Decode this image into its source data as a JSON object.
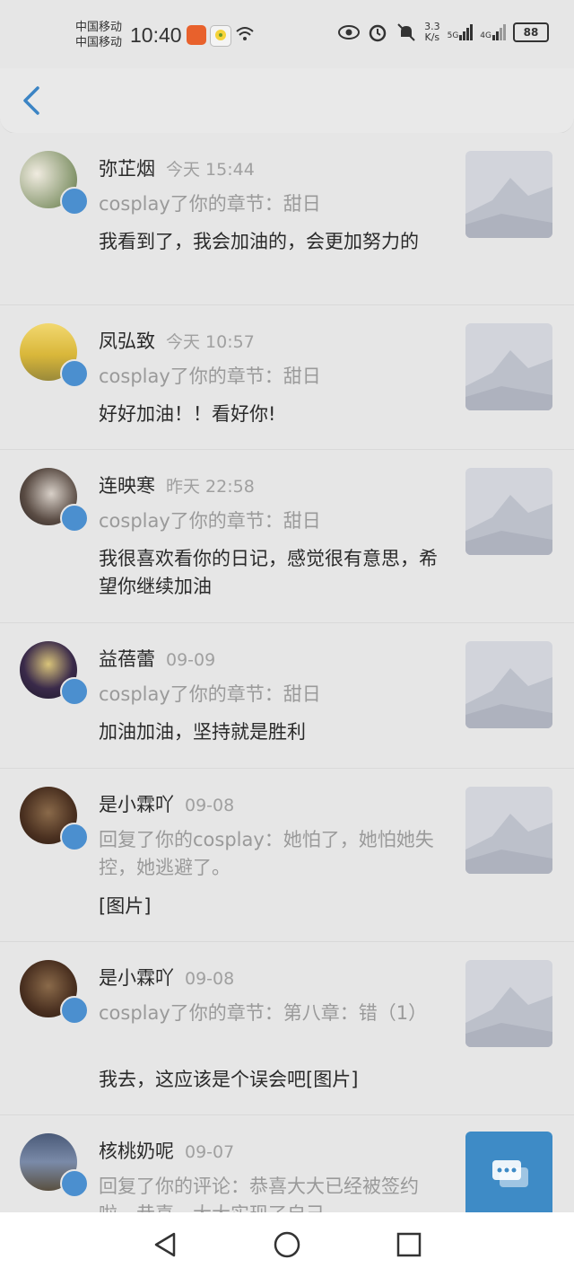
{
  "status": {
    "carrier1": "中国移动",
    "carrier2": "中国移动",
    "time": "10:40",
    "speed_top": "3.3",
    "speed_bottom": "K/s",
    "net1": "5G",
    "net2": "4G",
    "battery": "88"
  },
  "items": [
    {
      "name": "弥芷烟",
      "date": "今天 15:44",
      "sub": "cosplay了你的章节：甜日",
      "text": "我看到了，我会加油的，会更加努力的"
    },
    {
      "name": "凤弘致",
      "date": "今天 10:57",
      "sub": "cosplay了你的章节：甜日",
      "text": "好好加油！！看好你!"
    },
    {
      "name": "连映寒",
      "date": "昨天 22:58",
      "sub": "cosplay了你的章节：甜日",
      "text": "我很喜欢看你的日记，感觉很有意思，希望你继续加油"
    },
    {
      "name": "益蓓蕾",
      "date": "09-09",
      "sub": "cosplay了你的章节：甜日",
      "text": "加油加油，坚持就是胜利"
    },
    {
      "name": "是小霖吖",
      "date": "09-08",
      "sub": "回复了你的cosplay：她怕了，她怕她失控，她逃避了。",
      "text": "[图片]"
    },
    {
      "name": "是小霖吖",
      "date": "09-08",
      "sub": "cosplay了你的章节：第八章：错（1）",
      "text": "我去，这应该是个误会吧[图片]"
    },
    {
      "name": "核桃奶呢",
      "date": "09-07",
      "sub": "回复了你的评论：恭喜大大已经被签约啦，恭喜，大大实现了自己",
      "text": ""
    }
  ]
}
